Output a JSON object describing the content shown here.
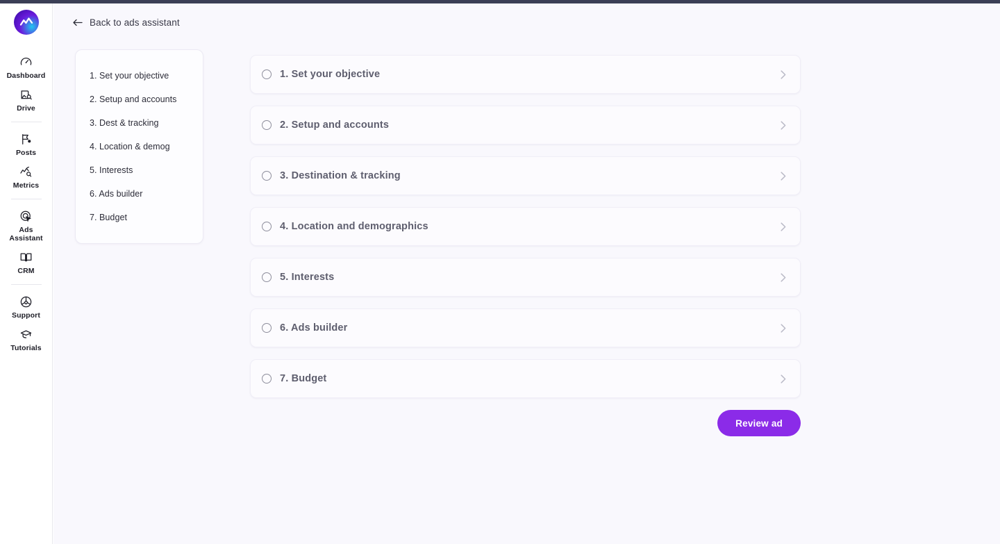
{
  "theme": {
    "accent": "#8b2be8",
    "page_bg": "#f9f8fd",
    "rail_bg": "#ffffff",
    "card_bg": "#fcfbfe",
    "title_color": "#5e5e6e",
    "top_chrome": "#3b3f56"
  },
  "rail": {
    "logo_name": "app-logo",
    "groups": [
      {
        "items": [
          {
            "id": "dashboard",
            "label": "Dashboard",
            "icon": "gauge-icon"
          },
          {
            "id": "drive",
            "label": "Drive",
            "icon": "media-search-icon"
          }
        ]
      },
      {
        "items": [
          {
            "id": "posts",
            "label": "Posts",
            "icon": "flag-icon"
          },
          {
            "id": "metrics",
            "label": "Metrics",
            "icon": "chart-search-icon"
          }
        ]
      },
      {
        "items": [
          {
            "id": "ads-assistant",
            "label": "Ads\nAssistant",
            "label_line1": "Ads",
            "label_line2": "Assistant",
            "icon": "target-cursor-icon"
          },
          {
            "id": "crm",
            "label": "CRM",
            "icon": "book-icon"
          }
        ]
      },
      {
        "items": [
          {
            "id": "support",
            "label": "Support",
            "icon": "lifebuoy-icon"
          },
          {
            "id": "tutorials",
            "label": "Tutorials",
            "icon": "graduation-cap-icon"
          }
        ]
      }
    ]
  },
  "back_link": {
    "label": "Back to ads assistant",
    "icon": "arrow-left-icon"
  },
  "steps_nav": {
    "items": [
      {
        "label": "1. Set your objective"
      },
      {
        "label": "2. Setup and accounts"
      },
      {
        "label": "3. Dest & tracking"
      },
      {
        "label": "4. Location & demog"
      },
      {
        "label": "5. Interests"
      },
      {
        "label": "6. Ads builder"
      },
      {
        "label": "7. Budget"
      }
    ]
  },
  "cards": [
    {
      "title": "1. Set your objective",
      "checked": false
    },
    {
      "title": "2. Setup and accounts",
      "checked": false
    },
    {
      "title": "3. Destination & tracking",
      "checked": false
    },
    {
      "title": "4. Location and demographics",
      "checked": false
    },
    {
      "title": "5. Interests",
      "checked": false
    },
    {
      "title": "6. Ads builder",
      "checked": false
    },
    {
      "title": "7. Budget",
      "checked": false
    }
  ],
  "review_button": {
    "label": "Review ad"
  }
}
